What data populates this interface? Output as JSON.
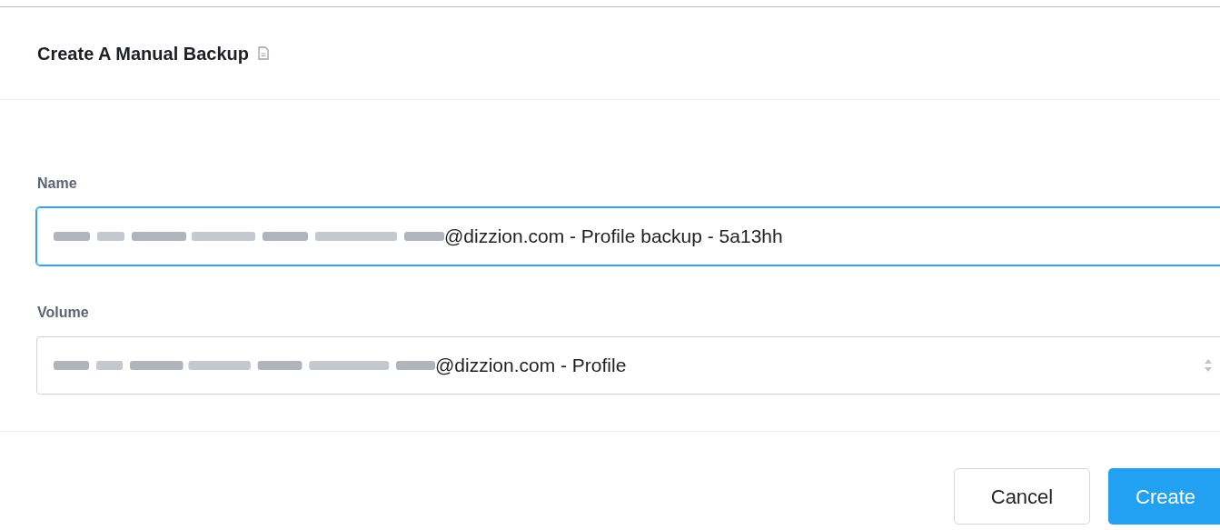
{
  "dialog": {
    "title": "Create A Manual Backup"
  },
  "fields": [
    {
      "kind": "input",
      "label": "Name",
      "value": "@dizzion.com - Profile backup - 5a13hh",
      "focused": true
    },
    {
      "kind": "select",
      "label": "Volume",
      "value": "@dizzion.com - Profile",
      "focused": false
    }
  ],
  "buttons": [
    {
      "label": "Cancel",
      "primary": false
    },
    {
      "label": "Create",
      "primary": true
    }
  ]
}
